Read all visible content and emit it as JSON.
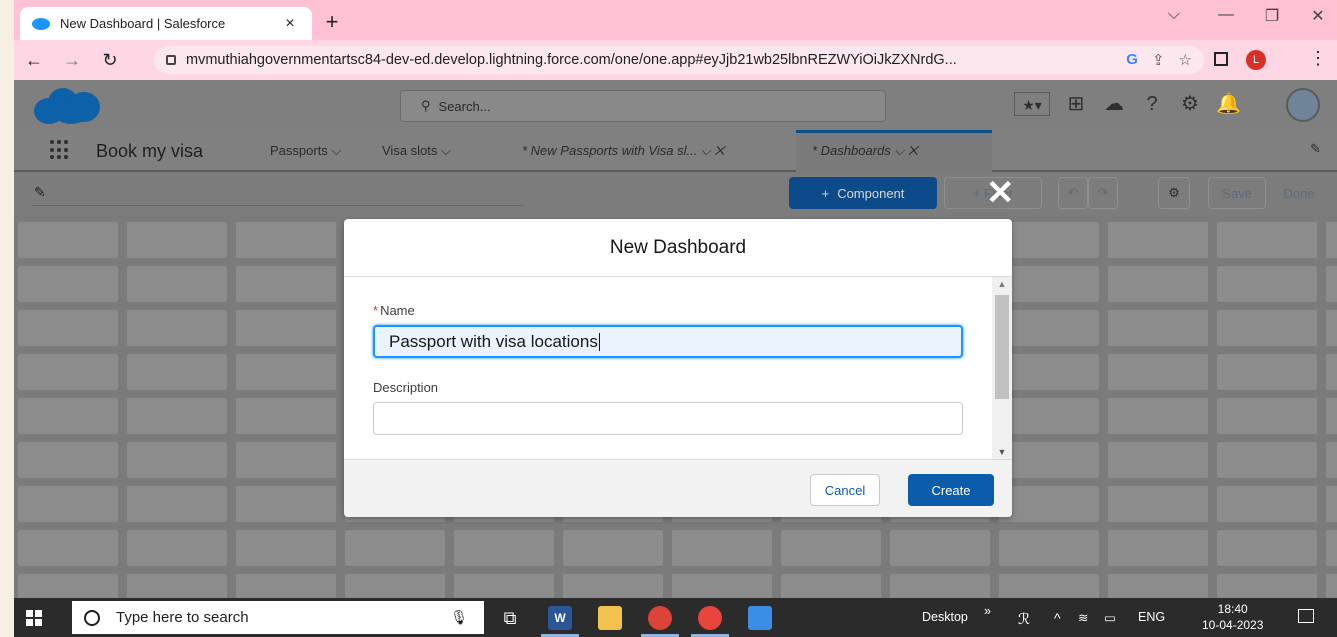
{
  "browser": {
    "tab_title": "New Dashboard | Salesforce",
    "tab_close": "×",
    "new_tab": "+",
    "url": "mvmuthiahgovernmentartsc84-dev-ed.develop.lightning.force.com/one/one.app#eyJjb21wb25lbnREZWYiOiJkZXNrdG..."
  },
  "sf_header": {
    "search_placeholder": "Search..."
  },
  "app_nav": {
    "app_name": "Book my visa",
    "items": [
      {
        "label": "Passports ⌵"
      },
      {
        "label": "Visa slots ⌵"
      },
      {
        "label": "* New Passports with Visa sl...  ⌵  ✕"
      },
      {
        "label": "* Dashboards  ⌵  ✕"
      }
    ]
  },
  "toolbar": {
    "component_label": "Component",
    "filter_label": "+ Filter",
    "save_label": "Save",
    "done_label": "Done"
  },
  "modal": {
    "title": "New Dashboard",
    "name_required_mark": "*",
    "name_label": "Name",
    "name_value": "Passport with visa locations",
    "description_label": "Description",
    "description_value": "",
    "cancel_label": "Cancel",
    "create_label": "Create"
  },
  "taskbar": {
    "search_placeholder": "Type here to search",
    "desktop_label": "Desktop",
    "lang": "ENG",
    "time": "18:40",
    "date": "10-04-2023"
  },
  "colors": {
    "tabbar": "#ffc1d3",
    "brand_blue": "#0b5cab",
    "focus_blue": "#1b96ff"
  }
}
